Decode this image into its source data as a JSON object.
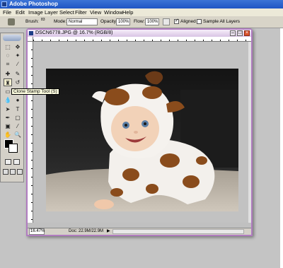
{
  "app": {
    "title": "Adobe Photoshop"
  },
  "menu": [
    "File",
    "Edit",
    "Image",
    "Layer",
    "Select",
    "Filter",
    "View",
    "Window",
    "Help"
  ],
  "options": {
    "brush_label": "Brush:",
    "brush_size": "83",
    "mode_label": "Mode:",
    "mode_value": "Normal",
    "opacity_label": "Opacity:",
    "opacity_value": "100%",
    "flow_label": "Flow:",
    "flow_value": "100%",
    "aligned_label": "Aligned",
    "aligned_checked": true,
    "sample_all_label": "Sample All Layers",
    "sample_all_checked": false
  },
  "tooltip": "Clone Stamp Tool (S)",
  "document": {
    "title": "DSCN6778.JPG @ 16.7% (RGB/8)",
    "zoom": "16.47%",
    "doc_info": "Doc: 22.9M/22.9M"
  },
  "icons": {
    "active_tool": "clone-stamp-icon",
    "foreground_color": "#000000",
    "background_color": "#ffffff"
  }
}
